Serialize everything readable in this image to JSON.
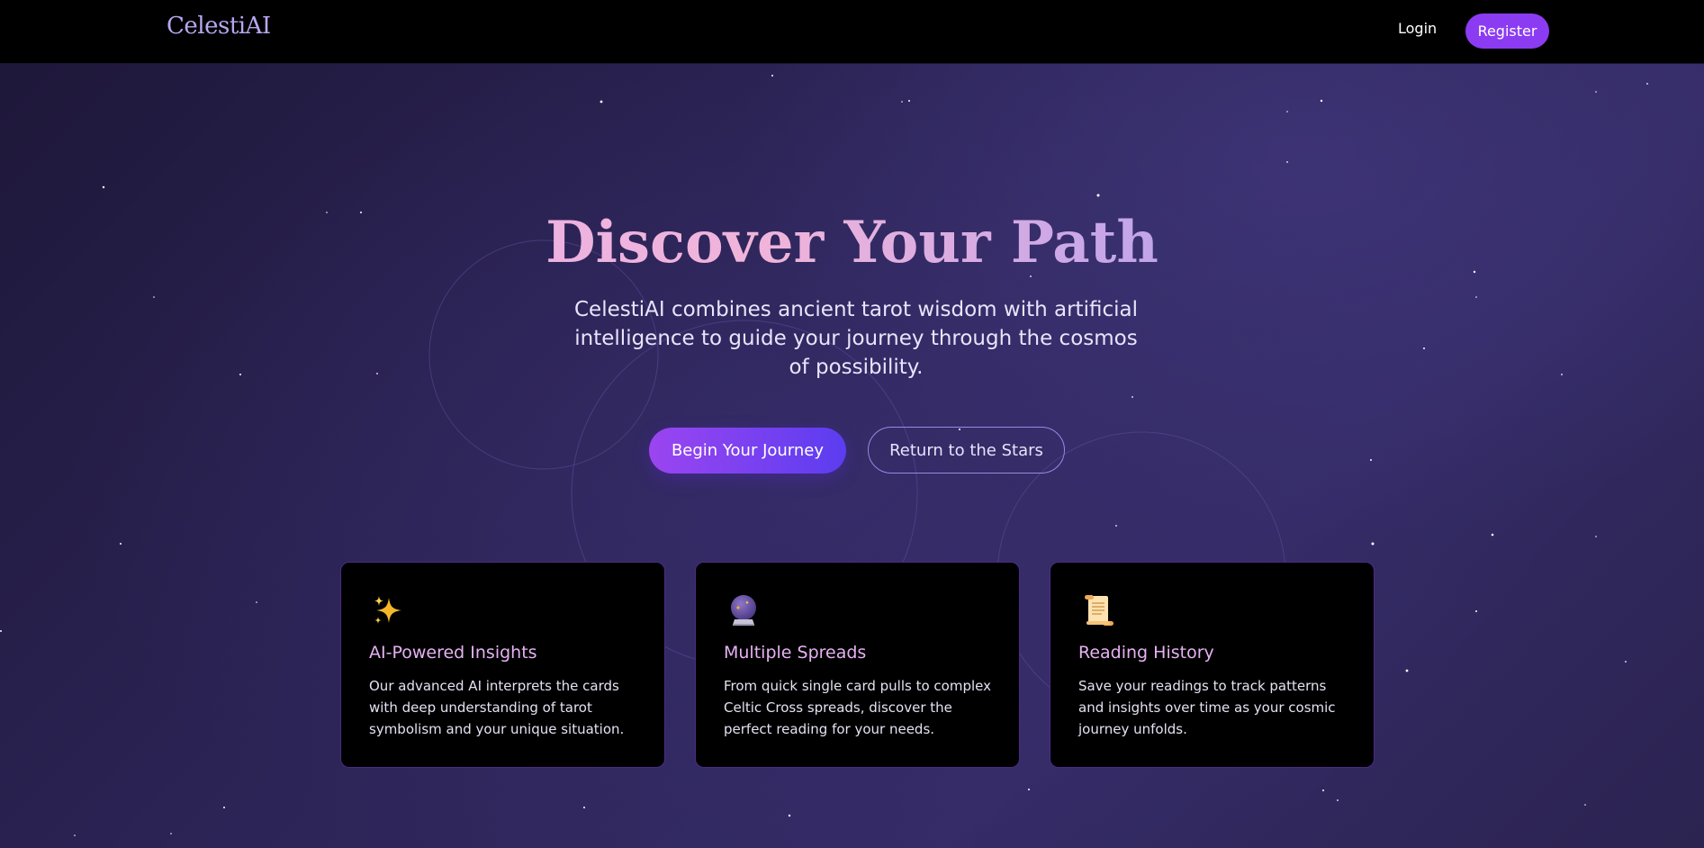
{
  "app": {
    "logo": "CelestiAI"
  },
  "nav": {
    "login_label": "Login",
    "register_label": "Register"
  },
  "hero": {
    "title": "Discover Your Path",
    "subtitle": "CelestiAI combines ancient tarot wisdom with artificial intelligence to guide your journey through the cosmos of possibility.",
    "primary_button": "Begin Your Journey",
    "secondary_button": "Return to the Stars"
  },
  "features": [
    {
      "icon": "sparkles-icon",
      "title": "AI-Powered Insights",
      "description": "Our advanced AI interprets the cards with deep understanding of tarot symbolism and your unique situation."
    },
    {
      "icon": "crystal-ball-icon",
      "title": "Multiple Spreads",
      "description": "From quick single card pulls to complex Celtic Cross spreads, discover the perfect reading for your needs."
    },
    {
      "icon": "scroll-icon",
      "title": "Reading History",
      "description": "Save your readings to track patterns and insights over time as your cosmic journey unfolds."
    }
  ],
  "colors": {
    "navbar_bg": "#000000",
    "accent_purple": "#8b3cf2",
    "card_border": "#4d2a84",
    "card_title": "#e6b2f2",
    "background": "#2d2558"
  }
}
